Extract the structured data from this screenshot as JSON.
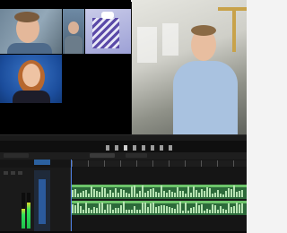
{
  "app": {
    "title": ""
  },
  "source_monitor": {
    "tiles": [
      "speaker-tile-man",
      "speaker-tile-person-b",
      "speaker-tile-graphic",
      "speaker-tile-woman"
    ]
  },
  "program_monitor": {
    "shot": "man-in-office"
  },
  "timeline": {
    "tabs": [
      "",
      "",
      ""
    ],
    "audio_tracks": [
      "",
      ""
    ]
  },
  "colors": {
    "playhead": "#4d7fe0",
    "audio_clip": "#2c6a3a",
    "audio_label": "#6cc46a",
    "meter_green": "#2fe05c"
  },
  "levels": {
    "meter_left": 0.55,
    "meter_right": 0.72
  }
}
